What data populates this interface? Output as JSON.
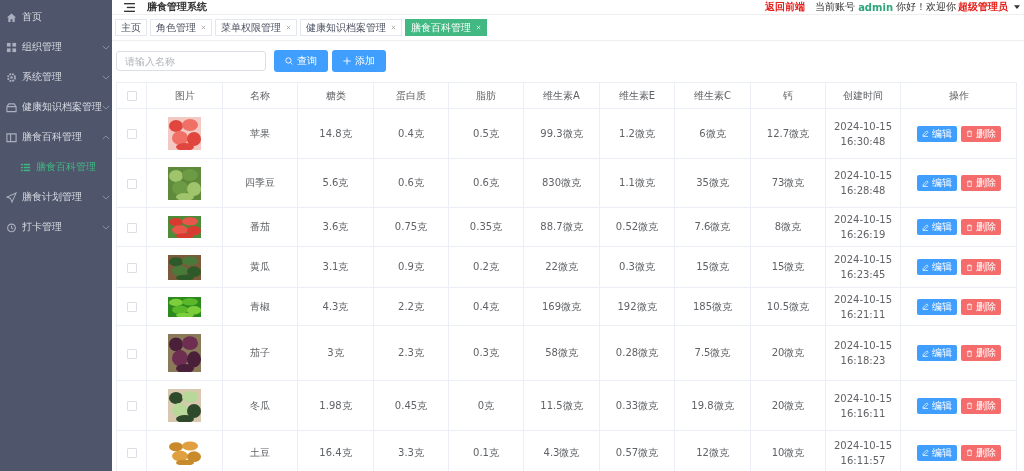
{
  "sidebar": {
    "items": [
      {
        "label": "首页"
      },
      {
        "label": "组织管理",
        "expanded": false
      },
      {
        "label": "系统管理",
        "expanded": false
      },
      {
        "label": "健康知识档案管理",
        "expanded": false
      },
      {
        "label": "膳食百科管理",
        "expanded": true,
        "children": [
          {
            "label": "膳食百科管理",
            "selected": true
          }
        ]
      },
      {
        "label": "膳食计划管理",
        "expanded": false
      },
      {
        "label": "打卡管理",
        "expanded": false
      }
    ]
  },
  "header": {
    "title": "膳食管理系统",
    "back_link": "返回前端",
    "account_label": "当前账号",
    "username": "admin",
    "greeting": "你好！欢迎你",
    "role": "超级管理员"
  },
  "tags": [
    {
      "label": "主页",
      "closable": false,
      "selected": false
    },
    {
      "label": "角色管理",
      "closable": true,
      "selected": false
    },
    {
      "label": "菜单权限管理",
      "closable": true,
      "selected": false
    },
    {
      "label": "健康知识档案管理",
      "closable": true,
      "selected": false
    },
    {
      "label": "膳食百科管理",
      "closable": true,
      "selected": true
    }
  ],
  "search": {
    "placeholder": "请输入名称",
    "buttons": [
      {
        "kind": "search",
        "label": "查询"
      },
      {
        "kind": "add",
        "label": "添加"
      }
    ]
  },
  "table": {
    "select_all": {
      "checked": false
    },
    "columns": [
      "图片",
      "名称",
      "糖类",
      "蛋白质",
      "脂肪",
      "维生素A",
      "维生素E",
      "维生素C",
      "钙",
      "创建时间",
      "操作"
    ],
    "rows": [
      {
        "checked": false,
        "cells": [
          "",
          "苹果",
          "14.8克",
          "0.4克",
          "0.5克",
          "99.3微克",
          "1.2微克",
          "6微克",
          "12.7微克",
          "2024-10-15 16:30:48"
        ],
        "actions": [
          {
            "kind": "edit",
            "label": "编辑"
          },
          {
            "kind": "delete",
            "label": "删除"
          }
        ]
      },
      {
        "checked": false,
        "cells": [
          "",
          "四季豆",
          "5.6克",
          "0.6克",
          "0.6克",
          "830微克",
          "1.1微克",
          "35微克",
          "73微克",
          "2024-10-15 16:28:48"
        ],
        "actions": [
          {
            "kind": "edit",
            "label": "编辑"
          },
          {
            "kind": "delete",
            "label": "删除"
          }
        ]
      },
      {
        "checked": false,
        "cells": [
          "",
          "番茄",
          "3.6克",
          "0.75克",
          "0.35克",
          "88.7微克",
          "0.52微克",
          "7.6微克",
          "8微克",
          "2024-10-15 16:26:19"
        ],
        "actions": [
          {
            "kind": "edit",
            "label": "编辑"
          },
          {
            "kind": "delete",
            "label": "删除"
          }
        ]
      },
      {
        "checked": false,
        "cells": [
          "",
          "黄瓜",
          "3.1克",
          "0.9克",
          "0.2克",
          "22微克",
          "0.3微克",
          "15微克",
          "15微克",
          "2024-10-15 16:23:45"
        ],
        "actions": [
          {
            "kind": "edit",
            "label": "编辑"
          },
          {
            "kind": "delete",
            "label": "删除"
          }
        ]
      },
      {
        "checked": false,
        "cells": [
          "",
          "青椒",
          "4.3克",
          "2.2克",
          "0.4克",
          "169微克",
          "192微克",
          "185微克",
          "10.5微克",
          "2024-10-15 16:21:11"
        ],
        "actions": [
          {
            "kind": "edit",
            "label": "编辑"
          },
          {
            "kind": "delete",
            "label": "删除"
          }
        ]
      },
      {
        "checked": false,
        "cells": [
          "",
          "茄子",
          "3克",
          "2.3克",
          "0.3克",
          "58微克",
          "0.28微克",
          "7.5微克",
          "20微克",
          "2024-10-15 16:18:23"
        ],
        "actions": [
          {
            "kind": "edit",
            "label": "编辑"
          },
          {
            "kind": "delete",
            "label": "删除"
          }
        ]
      },
      {
        "checked": false,
        "cells": [
          "",
          "冬瓜",
          "1.98克",
          "0.45克",
          "0克",
          "11.5微克",
          "0.33微克",
          "19.8微克",
          "20微克",
          "2024-10-15 16:16:11"
        ],
        "actions": [
          {
            "kind": "edit",
            "label": "编辑"
          },
          {
            "kind": "delete",
            "label": "删除"
          }
        ]
      },
      {
        "checked": false,
        "cells": [
          "",
          "土豆",
          "16.4克",
          "3.3克",
          "0.1克",
          "4.3微克",
          "0.57微克",
          "12微克",
          "10微克",
          "2024-10-15 16:11:57"
        ],
        "actions": [
          {
            "kind": "edit",
            "label": "编辑"
          },
          {
            "kind": "delete",
            "label": "删除"
          }
        ]
      }
    ]
  }
}
